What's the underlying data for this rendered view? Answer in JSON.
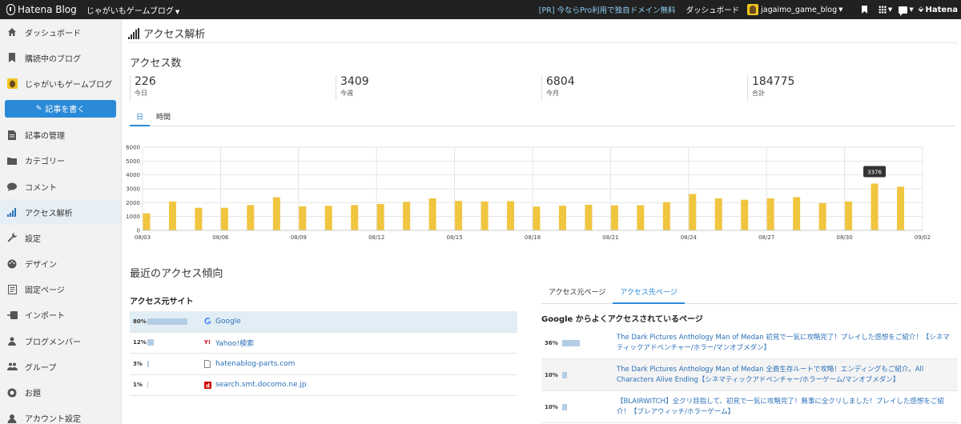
{
  "topbar": {
    "brand": "Hatena Blog",
    "blog_name": "じゃがいもゲームブログ",
    "pr_link": "[PR] 今ならPro利用で独自ドメイン無料",
    "dashboard": "ダッシュボード",
    "username": "jagaimo_game_blog",
    "hatena": "Hatena"
  },
  "sidebar": {
    "write_button": "記事を書く",
    "items": [
      {
        "label": "ダッシュボード",
        "icon": "home-icon"
      },
      {
        "label": "購読中のブログ",
        "icon": "bookmark-icon"
      },
      {
        "label": "じゃがいもゲームブログ",
        "icon": "blog-avatar"
      },
      {
        "label": "記事の管理",
        "icon": "document-icon"
      },
      {
        "label": "カテゴリー",
        "icon": "folder-icon"
      },
      {
        "label": "コメント",
        "icon": "comment-icon"
      },
      {
        "label": "アクセス解析",
        "icon": "signal-icon"
      },
      {
        "label": "設定",
        "icon": "wrench-icon"
      },
      {
        "label": "デザイン",
        "icon": "palette-icon"
      },
      {
        "label": "固定ページ",
        "icon": "page-icon"
      },
      {
        "label": "インポート",
        "icon": "import-icon"
      },
      {
        "label": "ブログメンバー",
        "icon": "members-icon"
      },
      {
        "label": "グループ",
        "icon": "group-icon"
      },
      {
        "label": "お題",
        "icon": "theme-icon"
      },
      {
        "label": "アカウント設定",
        "icon": "account-icon"
      }
    ]
  },
  "page_title": "アクセス解析",
  "access_count": {
    "title": "アクセス数",
    "stats": [
      {
        "value": "226",
        "label": "今日"
      },
      {
        "value": "3409",
        "label": "今週"
      },
      {
        "value": "6804",
        "label": "今月"
      },
      {
        "value": "184775",
        "label": "合計"
      }
    ],
    "tabs": [
      "日",
      "時間"
    ]
  },
  "chart_data": {
    "type": "bar",
    "title": "",
    "xlabel": "",
    "ylabel": "",
    "ylim": [
      0,
      6000
    ],
    "yticks": [
      0,
      1000,
      2000,
      3000,
      4000,
      5000,
      6000
    ],
    "categories": [
      "08/03",
      "08/04",
      "08/05",
      "08/06",
      "08/07",
      "08/08",
      "08/09",
      "08/10",
      "08/11",
      "08/12",
      "08/13",
      "08/14",
      "08/15",
      "08/16",
      "08/17",
      "08/18",
      "08/19",
      "08/20",
      "08/21",
      "08/22",
      "08/23",
      "08/24",
      "08/25",
      "08/26",
      "08/27",
      "08/28",
      "08/29",
      "08/30",
      "08/31",
      "09/01",
      "09/02"
    ],
    "xtick_labels": [
      "08/03",
      "08/06",
      "08/09",
      "08/12",
      "08/15",
      "08/18",
      "08/21",
      "08/24",
      "08/27",
      "08/30",
      "09/02"
    ],
    "values": [
      1230,
      2080,
      1630,
      1630,
      1830,
      2390,
      1730,
      1770,
      1830,
      1900,
      2060,
      2310,
      2130,
      2090,
      2110,
      1720,
      1780,
      1850,
      1810,
      1820,
      2040,
      2630,
      2310,
      2210,
      2310,
      2400,
      1970,
      2090,
      3376,
      3150,
      0
    ],
    "tooltip": "3376",
    "color": "#f0c540",
    "grid": true
  },
  "trend": {
    "title": "最近のアクセス傾向",
    "source_title": "アクセス元サイト",
    "sources": [
      {
        "pct": "80%",
        "ratio": 0.8,
        "name": "Google",
        "icon": "google-icon"
      },
      {
        "pct": "12%",
        "ratio": 0.12,
        "name": "Yahoo!検索",
        "icon": "yahoo-icon"
      },
      {
        "pct": "3%",
        "ratio": 0.03,
        "name": "hatenablog-parts.com",
        "icon": "page-icon"
      },
      {
        "pct": "1%",
        "ratio": 0.01,
        "name": "search.smt.docomo.ne.jp",
        "icon": "docomo-icon"
      }
    ],
    "dest_tabs": [
      "アクセス元ページ",
      "アクセス先ページ"
    ],
    "dest_title": "Google からよくアクセスされているページ",
    "destinations": [
      {
        "pct": "36%",
        "ratio": 0.36,
        "text": "The Dark Pictures Anthology Man of Medan 初見で一気に攻略完了！プレイした感想をご紹介！【シネマティックアドベンチャー/ホラー/マンオブメダン】"
      },
      {
        "pct": "10%",
        "ratio": 0.1,
        "text": "The Dark Pictures Anthology Man of Medan 全員生存ルートで攻略！エンディングもご紹介。All Characters Alive Ending【シネマティックアドベンチャー/ホラーゲーム/マンオブメダン】"
      },
      {
        "pct": "10%",
        "ratio": 0.1,
        "text": "【BLAIRWITCH】全クリ目指して、初見で一気に攻略完了！無事に全クリしました！プレイした感想をご紹介！【ブレアウィッチ/ホラーゲーム】"
      }
    ]
  }
}
